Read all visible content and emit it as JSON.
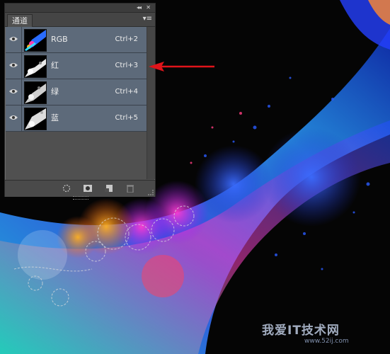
{
  "panel": {
    "tab_label": "通道",
    "collapse_glyph": "◂◂",
    "close_glyph": "✕",
    "menu_glyph": "▾≡"
  },
  "channels": [
    {
      "name": "RGB",
      "shortcut": "Ctrl+2",
      "thumb": "rgb-composite"
    },
    {
      "name": "红",
      "shortcut": "Ctrl+3",
      "thumb": "red-channel"
    },
    {
      "name": "绿",
      "shortcut": "Ctrl+4",
      "thumb": "green-channel"
    },
    {
      "name": "蓝",
      "shortcut": "Ctrl+5",
      "thumb": "blue-channel"
    }
  ],
  "bottom_buttons": [
    {
      "name": "load-selection-icon"
    },
    {
      "name": "save-selection-mask-icon"
    },
    {
      "name": "new-channel-icon"
    },
    {
      "name": "delete-channel-icon"
    }
  ],
  "annotation": {
    "arrow_color": "#e0141a"
  },
  "watermark": {
    "text": "我爱IT技术网",
    "url": "www.52ij.com"
  },
  "colors": {
    "panel_bg": "#505050",
    "selected_row": "#5d6a7a",
    "canvas_bg": "#050505"
  }
}
